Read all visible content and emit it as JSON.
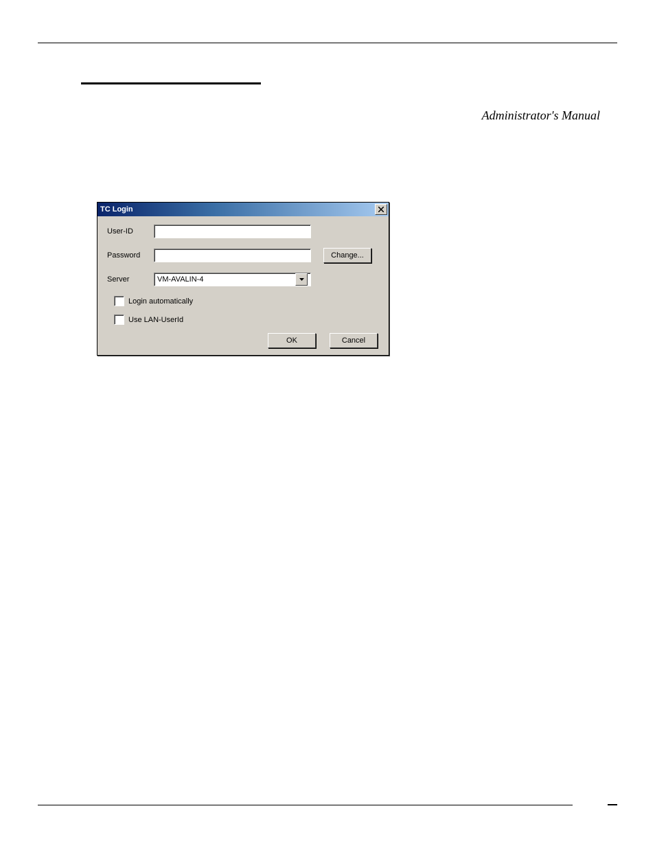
{
  "header": {
    "right_text": "Administrator's Manual"
  },
  "dialog": {
    "title": "TC Login",
    "labels": {
      "userid": "User-ID",
      "password": "Password",
      "server": "Server"
    },
    "values": {
      "userid": "",
      "password": "",
      "server": "VM-AVALIN-4"
    },
    "buttons": {
      "change": "Change...",
      "ok": "OK",
      "cancel": "Cancel"
    },
    "checkboxes": {
      "login_automatically": "Login automatically",
      "use_lan_userid": "Use LAN-UserId"
    }
  }
}
